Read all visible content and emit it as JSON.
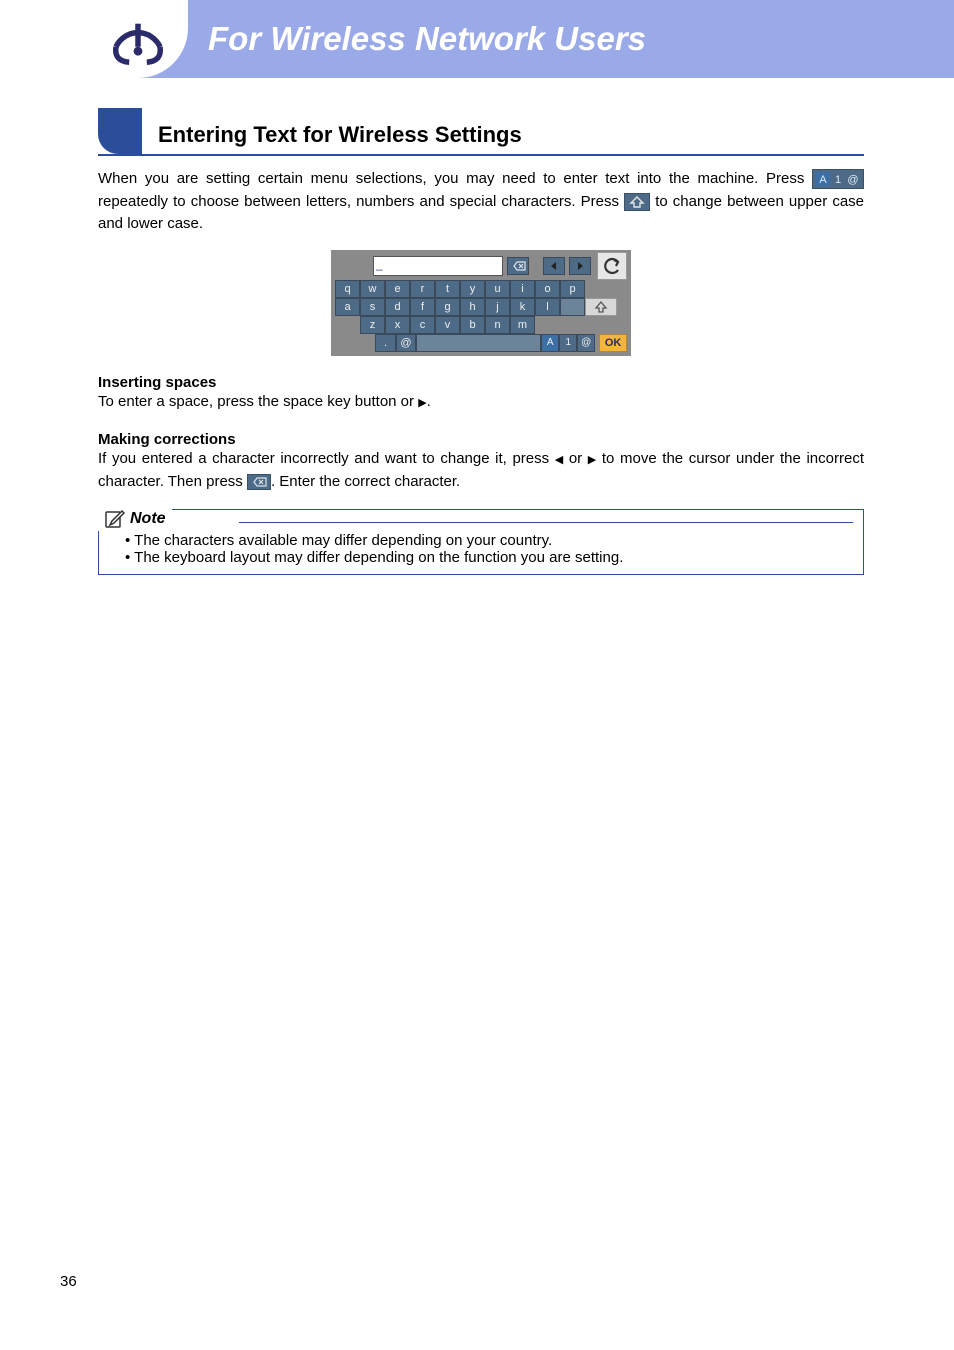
{
  "banner": {
    "title": "For Wireless Network Users"
  },
  "section": {
    "title": "Entering Text for Wireless Settings"
  },
  "intro": {
    "p1a": "When you are setting certain menu selections, you may need to enter text into the machine. Press ",
    "p1b": " repeatedly to choose between letters, numbers and special characters. Press ",
    "p1c": " to change between upper case and lower case."
  },
  "spaces": {
    "heading": "Inserting spaces",
    "text_a": "To enter a space, press the space key button or ",
    "text_b": "."
  },
  "corrections": {
    "heading": "Making corrections",
    "line1a": "If you entered a character incorrectly and want to change it, press ",
    "line1b": " or ",
    "line1c": " to move the cursor under the incorrect character. Then press ",
    "line1d": ". Enter the correct character."
  },
  "note": {
    "label": "Note",
    "items": [
      "The characters available may differ depending on your country.",
      "The keyboard layout may differ depending on the function you are setting."
    ]
  },
  "keyboard": {
    "input_cursor": "_",
    "rows": [
      [
        "q",
        "w",
        "e",
        "r",
        "t",
        "y",
        "u",
        "i",
        "o",
        "p"
      ],
      [
        "a",
        "s",
        "d",
        "f",
        "g",
        "h",
        "j",
        "k",
        "l"
      ],
      [
        "z",
        "x",
        "c",
        "v",
        "b",
        "n",
        "m"
      ]
    ],
    "punct": [
      ".",
      "@"
    ],
    "modes": [
      "A",
      "1",
      "@"
    ],
    "ok": "OK"
  },
  "tri_left": "◀",
  "tri_right": "▶",
  "page_number": "36"
}
